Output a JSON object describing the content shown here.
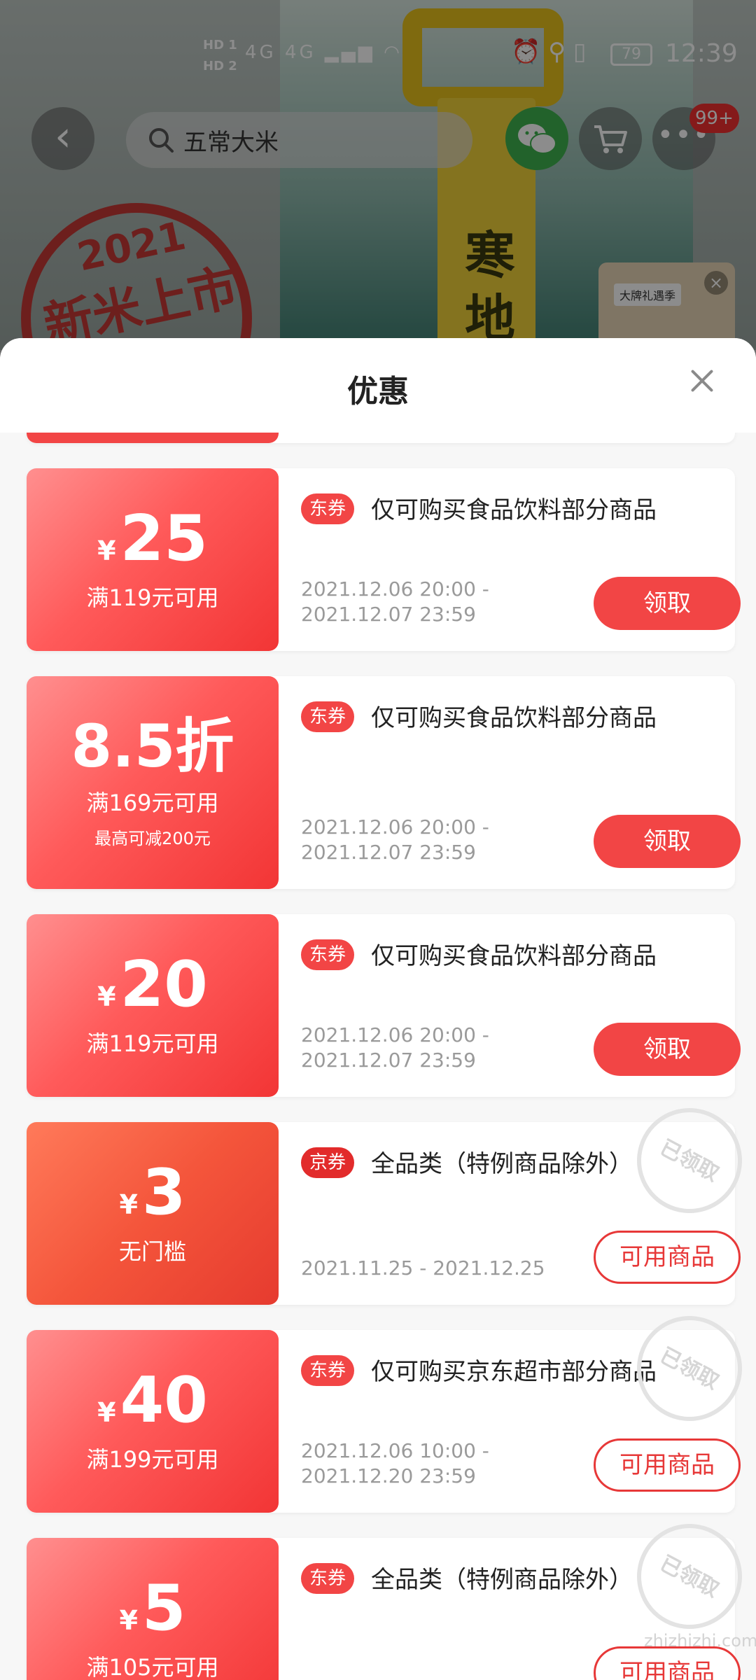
{
  "status_bar": {
    "hd1": "HD 1",
    "hd2": "HD 2",
    "signal": "4G 4G",
    "battery": "79",
    "time": "12:39"
  },
  "nav": {
    "search_text": "五常大米",
    "more_badge": "99+",
    "back_icon": "chevron-left-icon",
    "search_icon": "search-icon",
    "wechat_icon": "wechat-icon",
    "cart_icon": "cart-icon",
    "more_icon": "more-icon"
  },
  "background": {
    "badge_year": "2021",
    "badge_text": "新米上市",
    "bag_text": "寒地",
    "gift_label": "大牌礼遇季"
  },
  "sheet": {
    "title": "优惠"
  },
  "coupons": [
    {
      "currency": "¥",
      "amount": "25",
      "condition": "满119元可用",
      "tag": "东券",
      "description": "仅可购买食品饮料部分商品",
      "date_line1": "2021.12.06 20:00 -",
      "date_line2": "2021.12.07 23:59",
      "button": "领取"
    },
    {
      "amount": "8.5折",
      "condition": "满169元可用",
      "sub_condition": "最高可减200元",
      "tag": "东券",
      "description": "仅可购买食品饮料部分商品",
      "date_line1": "2021.12.06 20:00 -",
      "date_line2": "2021.12.07 23:59",
      "button": "领取"
    },
    {
      "currency": "¥",
      "amount": "20",
      "condition": "满119元可用",
      "tag": "东券",
      "description": "仅可购买食品饮料部分商品",
      "date_line1": "2021.12.06 20:00 -",
      "date_line2": "2021.12.07 23:59",
      "button": "领取"
    },
    {
      "currency": "¥",
      "amount": "3",
      "condition": "无门槛",
      "tag": "京券",
      "description": "全品类（特例商品除外）",
      "date_line1": "2021.11.25 - 2021.12.25",
      "button": "可用商品",
      "stamp": "已领取"
    },
    {
      "currency": "¥",
      "amount": "40",
      "condition": "满199元可用",
      "tag": "东券",
      "description": "仅可购买京东超市部分商品",
      "date_line1": "2021.12.06 10:00 -",
      "date_line2": "2021.12.20 23:59",
      "button": "可用商品",
      "stamp": "已领取"
    },
    {
      "currency": "¥",
      "amount": "5",
      "condition": "满105元可用",
      "tag": "东券",
      "description": "全品类（特例商品除外）",
      "button": "可用商品",
      "stamp": "已领取"
    }
  ],
  "watermark": "zhizhizhi.com"
}
